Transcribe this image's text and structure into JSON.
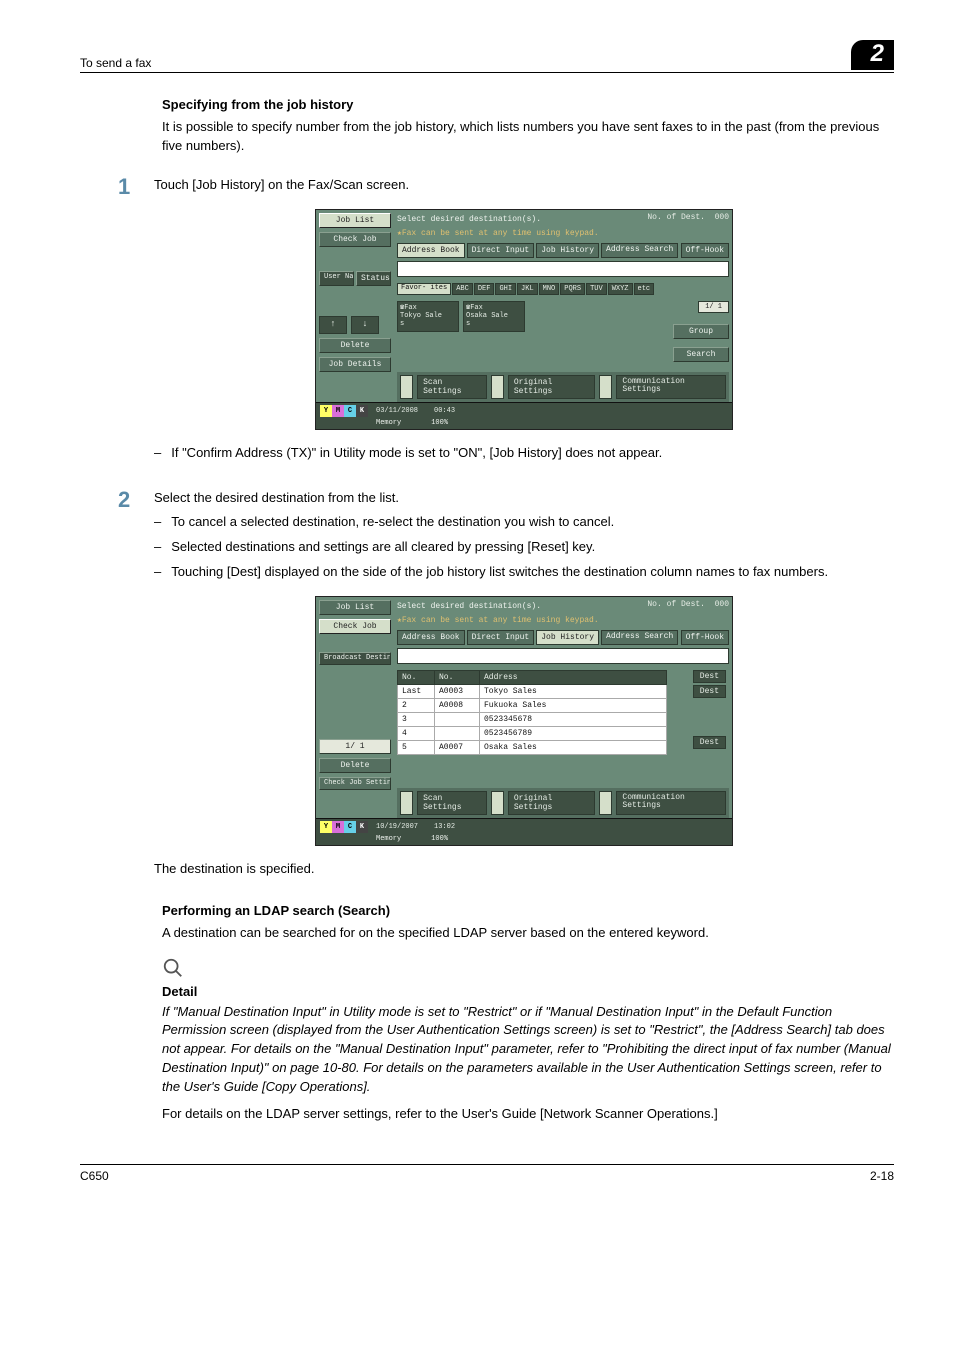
{
  "header": {
    "left": "To send a fax",
    "chapter": "2"
  },
  "sec1": {
    "title": "Specifying from the job history",
    "intro": "It is possible to specify number from the job history, which lists numbers you have sent faxes to in the past (from the previous five numbers).",
    "step1": {
      "num": "1",
      "text": "Touch [Job History] on the Fax/Scan screen."
    },
    "note_after_ss1": "If \"Confirm Address (TX)\" in Utility mode is set to \"ON\", [Job History] does not appear.",
    "step2": {
      "num": "2",
      "text": "Select the desired destination from the list.",
      "bullets": [
        "To cancel a selected destination, re-select the destination you wish to cancel.",
        "Selected destinations and settings are all cleared by pressing [Reset] key.",
        "Touching [Dest] displayed on the side of the job history list switches the destination column names to fax numbers."
      ]
    },
    "after_ss2": "The destination is specified."
  },
  "ss1": {
    "left": {
      "job_list": "Job List",
      "check_job": "Check Job",
      "user_name": "User\nName",
      "status": "Status",
      "delete": "Delete",
      "job_details": "Job Details"
    },
    "top_msg": "Select desired destination(s).",
    "dest_count_lbl": "No. of\nDest.",
    "dest_count": "000",
    "hint": "★Fax can be sent at any time using keypad.",
    "tabs": [
      "Address Book",
      "Direct Input",
      "Job History",
      "Address\nSearch",
      "Off-Hook"
    ],
    "alpha": [
      "Favor-\nites",
      "ABC",
      "DEF",
      "GHI",
      "JKL",
      "MNO",
      "PQRS",
      "TUV",
      "WXYZ",
      "etc"
    ],
    "cards": [
      {
        "t1": "☎Fax",
        "t2": "Tokyo Sale",
        "t3": "s"
      },
      {
        "t1": "☎Fax",
        "t2": "Osaka Sale",
        "t3": "s"
      }
    ],
    "page": "1/  1",
    "group": "Group",
    "search": "Search",
    "bottom": {
      "scan": "Scan Settings",
      "orig": "Original Settings",
      "comm": "Communication\nSettings"
    },
    "footer": {
      "date": "03/11/2008",
      "time": "00:43",
      "mem": "Memory",
      "pct": "100%"
    }
  },
  "ss2": {
    "left": {
      "job_list": "Job List",
      "check_job": "Check Job",
      "bcast": "Broadcast\nDestinations",
      "page": "1/  1",
      "delete": "Delete",
      "check_set": "Check Job\nSettings"
    },
    "top_msg": "Select desired destination(s).",
    "dest_count_lbl": "No. of\nDest.",
    "dest_count": "000",
    "hint": "★Fax can be sent at any time using keypad.",
    "tabs": [
      "Address Book",
      "Direct Input",
      "Job History",
      "Address\nSearch",
      "Off-Hook"
    ],
    "table": {
      "headers": [
        "No.",
        "No.",
        "Address"
      ],
      "rows": [
        [
          "Last",
          "A0003",
          "Tokyo Sales"
        ],
        [
          "2",
          "A0008",
          "Fukuoka Sales"
        ],
        [
          "3",
          "",
          "0523345678"
        ],
        [
          "4",
          "",
          "0523456789"
        ],
        [
          "5",
          "A0007",
          "Osaka Sales"
        ]
      ],
      "dest_btn": "Dest"
    },
    "bottom": {
      "scan": "Scan Settings",
      "orig": "Original Settings",
      "comm": "Communication\nSettings"
    },
    "footer": {
      "date": "10/19/2007",
      "time": "13:02",
      "mem": "Memory",
      "pct": "100%"
    }
  },
  "sec2": {
    "title": "Performing an LDAP search (Search)",
    "intro": "A destination can be searched for on the specified LDAP server based on the entered keyword.",
    "detail_label": "Detail",
    "detail_text": "If \"Manual Destination Input\" in Utility mode is set to \"Restrict\" or if \"Manual Destination Input\" in the Default Function Permission screen (displayed from the User Authentication Settings screen) is set to \"Restrict\", the [Address Search] tab does not appear. For details on the \"Manual Destination Input\" parameter, refer to \"Prohibiting the direct input of fax number (Manual Destination Input)\" on page 10-80. For details on the parameters available in the User Authentication Settings screen, refer to the User's Guide [Copy Operations].",
    "outro": "For details on the LDAP server settings, refer to the User's Guide [Network Scanner Operations.]"
  },
  "footer": {
    "left": "C650",
    "right": "2-18"
  }
}
